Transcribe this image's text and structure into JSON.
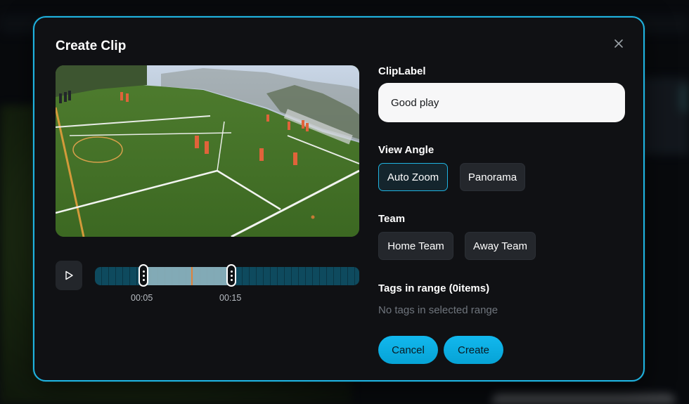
{
  "modal": {
    "title": "Create Clip",
    "close_icon": "close-icon"
  },
  "player": {
    "play_icon": "play-icon",
    "range_start": "00:05",
    "range_end": "00:15"
  },
  "form": {
    "clip_label": {
      "label": "ClipLabel",
      "value": "Good play"
    },
    "view_angle": {
      "label": "View Angle",
      "options": [
        "Auto Zoom",
        "Panorama"
      ],
      "selected": "Auto Zoom"
    },
    "team": {
      "label": "Team",
      "options": [
        "Home Team",
        "Away Team"
      ]
    },
    "tags": {
      "label": "Tags in range (0items)",
      "empty_text": "No tags in selected range"
    }
  },
  "actions": {
    "cancel_label": "Cancel",
    "create_label": "Create"
  },
  "colors": {
    "accent": "#1fb3e0",
    "modal_bg": "#101114",
    "timeline": "#0e4a5e",
    "playhead": "#e0823a"
  }
}
